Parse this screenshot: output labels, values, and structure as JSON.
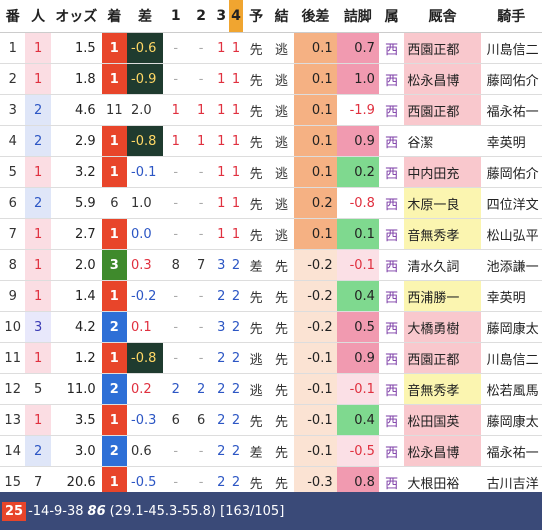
{
  "headers": [
    "番",
    "人",
    "オッズ",
    "着",
    "差",
    "1",
    "2",
    "3",
    "4",
    "予",
    "結",
    "後差",
    "詰脚",
    "属",
    "厩舎",
    "騎手"
  ],
  "rows": [
    {
      "no": "1",
      "pop": "1",
      "popc": "pop1",
      "odds": "1.5",
      "rank": "1",
      "rc": "r1",
      "margin": "-0.6",
      "mc": "dark",
      "c1": "-",
      "c1c": "cd",
      "c2": "-",
      "c2c": "cd",
      "c3": "1",
      "c3c": "c1",
      "c4": "1",
      "c4c": "c1",
      "yo": "先",
      "ke": "逃",
      "diff": "0.1",
      "last": "0.7",
      "lc": "lr",
      "stable": "西",
      "trainer": "西園正都",
      "tc": "tr",
      "jockey": "川島信二"
    },
    {
      "no": "2",
      "pop": "1",
      "popc": "pop1",
      "odds": "1.8",
      "rank": "1",
      "rc": "r1",
      "margin": "-0.9",
      "mc": "dark",
      "c1": "-",
      "c1c": "cd",
      "c2": "-",
      "c2c": "cd",
      "c3": "1",
      "c3c": "c1",
      "c4": "1",
      "c4c": "c1",
      "yo": "先",
      "ke": "逃",
      "diff": "0.1",
      "last": "1.0",
      "lc": "lr",
      "stable": "西",
      "trainer": "松永昌博",
      "tc": "tr",
      "jockey": "藤岡佑介"
    },
    {
      "no": "3",
      "pop": "2",
      "popc": "pop2",
      "odds": "4.6",
      "rank": "11",
      "rc": "rn",
      "margin": "2.0",
      "mc": "mn",
      "c1": "1",
      "c1c": "c1",
      "c2": "1",
      "c2c": "c1",
      "c3": "1",
      "c3c": "c1",
      "c4": "1",
      "c4c": "c1",
      "yo": "先",
      "ke": "逃",
      "diff": "0.1",
      "last": "-1.9",
      "lc": "ln",
      "stable": "西",
      "trainer": "西園正都",
      "tc": "tr",
      "jockey": "福永祐一"
    },
    {
      "no": "4",
      "pop": "2",
      "popc": "pop2",
      "odds": "2.9",
      "rank": "1",
      "rc": "r1",
      "margin": "-0.8",
      "mc": "dark",
      "c1": "1",
      "c1c": "c1",
      "c2": "1",
      "c2c": "c1",
      "c3": "1",
      "c3c": "c1",
      "c4": "1",
      "c4c": "c1",
      "yo": "先",
      "ke": "逃",
      "diff": "0.1",
      "last": "0.9",
      "lc": "lr",
      "stable": "西",
      "trainer": "谷潔",
      "tc": "tn",
      "jockey": "幸英明"
    },
    {
      "no": "5",
      "pop": "1",
      "popc": "pop1",
      "odds": "3.2",
      "rank": "1",
      "rc": "r1",
      "margin": "-0.1",
      "mc": "mb",
      "c1": "-",
      "c1c": "cd",
      "c2": "-",
      "c2c": "cd",
      "c3": "1",
      "c3c": "c1",
      "c4": "1",
      "c4c": "c1",
      "yo": "先",
      "ke": "逃",
      "diff": "0.1",
      "last": "0.2",
      "lc": "lg",
      "stable": "西",
      "trainer": "中内田充",
      "tc": "tr",
      "jockey": "藤岡佑介"
    },
    {
      "no": "6",
      "pop": "2",
      "popc": "pop2",
      "odds": "5.9",
      "rank": "6",
      "rc": "rn",
      "margin": "1.0",
      "mc": "mn",
      "c1": "-",
      "c1c": "cd",
      "c2": "-",
      "c2c": "cd",
      "c3": "1",
      "c3c": "c1",
      "c4": "1",
      "c4c": "c1",
      "yo": "先",
      "ke": "逃",
      "diff": "0.2",
      "last": "-0.8",
      "lc": "ln",
      "stable": "西",
      "trainer": "木原一良",
      "tc": "tg",
      "jockey": "四位洋文"
    },
    {
      "no": "7",
      "pop": "1",
      "popc": "pop1",
      "odds": "2.7",
      "rank": "1",
      "rc": "r1",
      "margin": "0.0",
      "mc": "mb",
      "c1": "-",
      "c1c": "cd",
      "c2": "-",
      "c2c": "cd",
      "c3": "1",
      "c3c": "c1",
      "c4": "1",
      "c4c": "c1",
      "yo": "先",
      "ke": "逃",
      "diff": "0.1",
      "last": "0.1",
      "lc": "lg",
      "stable": "西",
      "trainer": "音無秀孝",
      "tc": "tg",
      "jockey": "松山弘平"
    },
    {
      "no": "8",
      "pop": "1",
      "popc": "pop1",
      "odds": "2.0",
      "rank": "3",
      "rc": "r3",
      "margin": "0.3",
      "mc": "mr",
      "c1": "8",
      "c1c": "c3",
      "c2": "7",
      "c2c": "c3",
      "c3": "3",
      "c3c": "c2",
      "c4": "2",
      "c4c": "c2",
      "yo": "差",
      "ke": "先",
      "diff": "-0.2",
      "last": "-0.1",
      "lc": "lp",
      "stable": "西",
      "trainer": "清水久詞",
      "tc": "tn",
      "jockey": "池添謙一"
    },
    {
      "no": "9",
      "pop": "1",
      "popc": "pop1",
      "odds": "1.4",
      "rank": "1",
      "rc": "r1",
      "margin": "-0.2",
      "mc": "mb",
      "c1": "-",
      "c1c": "cd",
      "c2": "-",
      "c2c": "cd",
      "c3": "2",
      "c3c": "c2",
      "c4": "2",
      "c4c": "c2",
      "yo": "先",
      "ke": "先",
      "diff": "-0.2",
      "last": "0.4",
      "lc": "lg",
      "stable": "西",
      "trainer": "西浦勝一",
      "tc": "tg",
      "jockey": "幸英明"
    },
    {
      "no": "10",
      "pop": "3",
      "popc": "pop3",
      "odds": "4.2",
      "rank": "2",
      "rc": "r2",
      "margin": "0.1",
      "mc": "mr",
      "c1": "-",
      "c1c": "cd",
      "c2": "-",
      "c2c": "cd",
      "c3": "3",
      "c3c": "c2",
      "c4": "2",
      "c4c": "c2",
      "yo": "先",
      "ke": "先",
      "diff": "-0.2",
      "last": "0.5",
      "lc": "lr",
      "stable": "西",
      "trainer": "大橋勇樹",
      "tc": "tr",
      "jockey": "藤岡康太"
    },
    {
      "no": "11",
      "pop": "1",
      "popc": "pop1",
      "odds": "1.2",
      "rank": "1",
      "rc": "r1",
      "margin": "-0.8",
      "mc": "dark",
      "c1": "-",
      "c1c": "cd",
      "c2": "-",
      "c2c": "cd",
      "c3": "2",
      "c3c": "c2",
      "c4": "2",
      "c4c": "c2",
      "yo": "逃",
      "ke": "先",
      "diff": "-0.1",
      "last": "0.9",
      "lc": "lr",
      "stable": "西",
      "trainer": "西園正都",
      "tc": "tr",
      "jockey": "川島信二"
    },
    {
      "no": "12",
      "pop": "5",
      "popc": "pop5",
      "odds": "11.0",
      "rank": "2",
      "rc": "r2",
      "margin": "0.2",
      "mc": "mr",
      "c1": "2",
      "c1c": "c2",
      "c2": "2",
      "c2c": "c2",
      "c3": "2",
      "c3c": "c2",
      "c4": "2",
      "c4c": "c2",
      "yo": "逃",
      "ke": "先",
      "diff": "-0.1",
      "last": "-0.1",
      "lc": "lp",
      "stable": "西",
      "trainer": "音無秀孝",
      "tc": "tg",
      "jockey": "松若風馬"
    },
    {
      "no": "13",
      "pop": "1",
      "popc": "pop1",
      "odds": "3.5",
      "rank": "1",
      "rc": "r1",
      "margin": "-0.3",
      "mc": "mb",
      "c1": "6",
      "c1c": "c3",
      "c2": "6",
      "c2c": "c3",
      "c3": "2",
      "c3c": "c2",
      "c4": "2",
      "c4c": "c2",
      "yo": "先",
      "ke": "先",
      "diff": "-0.1",
      "last": "0.4",
      "lc": "lg",
      "stable": "西",
      "trainer": "松田国英",
      "tc": "tr",
      "jockey": "藤岡康太"
    },
    {
      "no": "14",
      "pop": "2",
      "popc": "pop2",
      "odds": "3.0",
      "rank": "2",
      "rc": "r2",
      "margin": "0.6",
      "mc": "mn",
      "c1": "-",
      "c1c": "cd",
      "c2": "-",
      "c2c": "cd",
      "c3": "2",
      "c3c": "c2",
      "c4": "2",
      "c4c": "c2",
      "yo": "差",
      "ke": "先",
      "diff": "-0.1",
      "last": "-0.5",
      "lc": "lp",
      "stable": "西",
      "trainer": "松永昌博",
      "tc": "tr",
      "jockey": "福永祐一"
    },
    {
      "no": "15",
      "pop": "7",
      "popc": "pop5",
      "odds": "20.6",
      "rank": "1",
      "rc": "r1",
      "margin": "-0.5",
      "mc": "mb",
      "c1": "-",
      "c1c": "cd",
      "c2": "-",
      "c2c": "cd",
      "c3": "2",
      "c3c": "c2",
      "c4": "2",
      "c4c": "c2",
      "yo": "先",
      "ke": "先",
      "diff": "-0.3",
      "last": "0.8",
      "lc": "lr",
      "stable": "西",
      "trainer": "大根田裕",
      "tc": "tn",
      "jockey": "古川吉洋"
    }
  ],
  "footer": {
    "num": "25",
    "dates": "-14-9-38",
    "bold": "86",
    "text": "(29.1-45.3-55.8) [163/105]"
  }
}
